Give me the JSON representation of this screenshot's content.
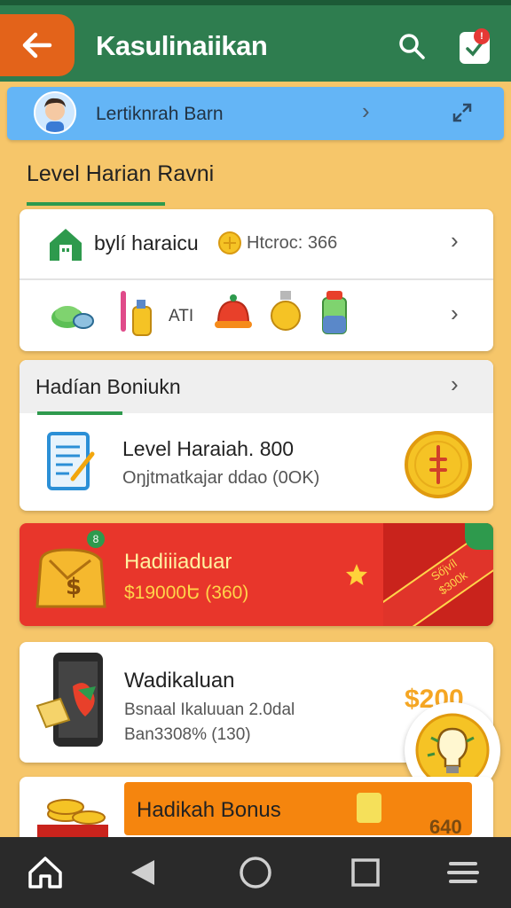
{
  "app": {
    "title": "Kasulinaiikan"
  },
  "user": {
    "name": "Lertiknrah Barn"
  },
  "section": {
    "title": "Level Harian Ravni"
  },
  "card1": {
    "title": "bylí haraicu",
    "coins_label": "Htcroc: 366",
    "item_text": "ATI"
  },
  "bonus": {
    "header": "Hadían Boniukn",
    "title": "Level Haraiah. 800",
    "subtitle": "Oŋjtmatkajar ddao (0OK)"
  },
  "red_card": {
    "title": "Hadiiiaduar",
    "value": "$19000Ե (360)",
    "bag_badge": "8",
    "ribbon_text": "Sőjvíl\n$300k"
  },
  "wadi": {
    "title": "Wadikaluan",
    "line1": "Bsnaal Ikaluuan 2.0dal",
    "line2": "Ban3308% (130)",
    "price": "$200"
  },
  "bottom_card": {
    "title": "Hadikah Bonus",
    "value": "640"
  },
  "notification_count": "!",
  "colors": {
    "appbar": "#2e7d4f",
    "accent": "#e3631a",
    "background": "#f6c66a",
    "red_card": "#e8362b",
    "blue_bar": "#64b5f6"
  }
}
